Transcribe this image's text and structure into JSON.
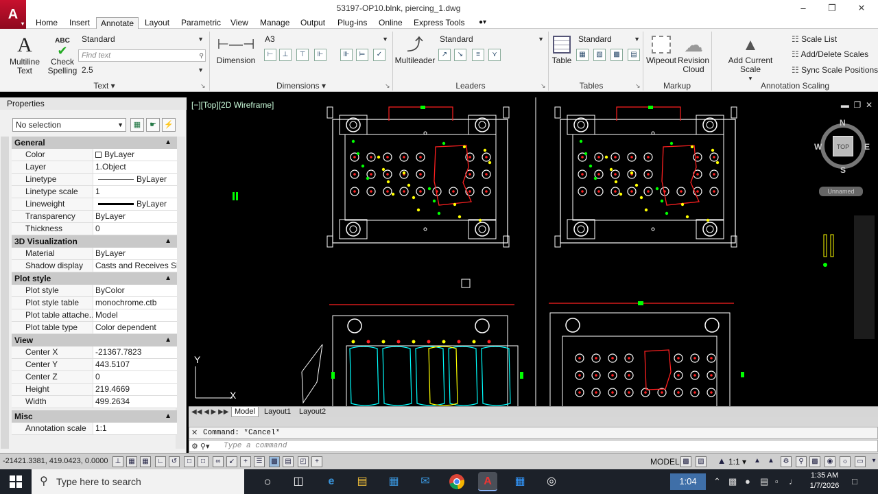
{
  "window": {
    "title": "53197-OP10.blnk, piercing_1.dwg"
  },
  "menu_tabs": [
    "Home",
    "Insert",
    "Annotate",
    "Layout",
    "Parametric",
    "View",
    "Manage",
    "Output",
    "Plug-ins",
    "Online",
    "Express Tools"
  ],
  "active_tab": "Annotate",
  "ribbon": {
    "text_panel": {
      "title": "Text",
      "multiline": "Multiline\nText",
      "check_spelling": "Check\nSpelling",
      "style": "Standard",
      "find_placeholder": "Find text",
      "height": "2.5"
    },
    "dimensions_panel": {
      "title": "Dimensions",
      "dimension_label": "Dimension",
      "style": "A3"
    },
    "leaders_panel": {
      "title": "Leaders",
      "multileader_label": "Multileader",
      "style": "Standard"
    },
    "tables_panel": {
      "title": "Tables",
      "table_label": "Table",
      "style": "Standard"
    },
    "markup_panel": {
      "title": "Markup",
      "wipeout": "Wipeout",
      "revision_cloud": "Revision\nCloud"
    },
    "annotation_scaling_panel": {
      "title": "Annotation Scaling",
      "add_current_scale": "Add Current Scale",
      "scale_list": "Scale List",
      "add_delete_scales": "Add/Delete Scales",
      "sync_scale_positions": "Sync Scale Positions"
    }
  },
  "properties": {
    "title": "Properties",
    "selection": "No selection",
    "sections": [
      {
        "name": "General",
        "rows": [
          {
            "k": "Color",
            "v": "ByLayer"
          },
          {
            "k": "Layer",
            "v": "1.Object"
          },
          {
            "k": "Linetype",
            "v": "ByLayer"
          },
          {
            "k": "Linetype scale",
            "v": "1"
          },
          {
            "k": "Lineweight",
            "v": "ByLayer"
          },
          {
            "k": "Transparency",
            "v": "ByLayer"
          },
          {
            "k": "Thickness",
            "v": "0"
          }
        ]
      },
      {
        "name": "3D Visualization",
        "rows": [
          {
            "k": "Material",
            "v": "ByLayer"
          },
          {
            "k": "Shadow display",
            "v": "Casts and Receives Sh..."
          }
        ]
      },
      {
        "name": "Plot style",
        "rows": [
          {
            "k": "Plot style",
            "v": "ByColor"
          },
          {
            "k": "Plot style table",
            "v": "monochrome.ctb"
          },
          {
            "k": "Plot table attache...",
            "v": "Model"
          },
          {
            "k": "Plot table type",
            "v": "Color dependent"
          }
        ]
      },
      {
        "name": "View",
        "rows": [
          {
            "k": "Center X",
            "v": "-21367.7823"
          },
          {
            "k": "Center Y",
            "v": "443.5107"
          },
          {
            "k": "Center Z",
            "v": "0"
          },
          {
            "k": "Height",
            "v": "219.4669"
          },
          {
            "k": "Width",
            "v": "499.2634"
          }
        ]
      },
      {
        "name": "Misc",
        "rows": [
          {
            "k": "Annotation scale",
            "v": "1:1"
          }
        ]
      }
    ]
  },
  "viewport": {
    "label": "[−][Top][2D Wireframe]",
    "cube_face": "TOP",
    "compass_n": "N",
    "compass_s": "S",
    "compass_e": "E",
    "compass_w": "W",
    "view_name": "Unnamed",
    "ucs_y": "Y",
    "ucs_x": "X"
  },
  "layout_tabs": [
    "Model",
    "Layout1",
    "Layout2"
  ],
  "command": {
    "history": "Command: *Cancel*",
    "placeholder": "Type a command"
  },
  "status": {
    "coords": "-21421.3381, 419.0423, 0.0000",
    "model": "MODEL",
    "scale": "1:1"
  },
  "taskbar": {
    "search_placeholder": "Type here to search",
    "timer": "1:04",
    "time": "1:35 AM",
    "date": "1/7/2026"
  },
  "colors": {
    "accent": "#c8102e",
    "drawing_bg": "#000000",
    "line_white": "#ffffff",
    "line_red": "#ff2020",
    "line_yellow": "#ffff00",
    "line_green": "#00ff00",
    "line_cyan": "#00ffff"
  }
}
